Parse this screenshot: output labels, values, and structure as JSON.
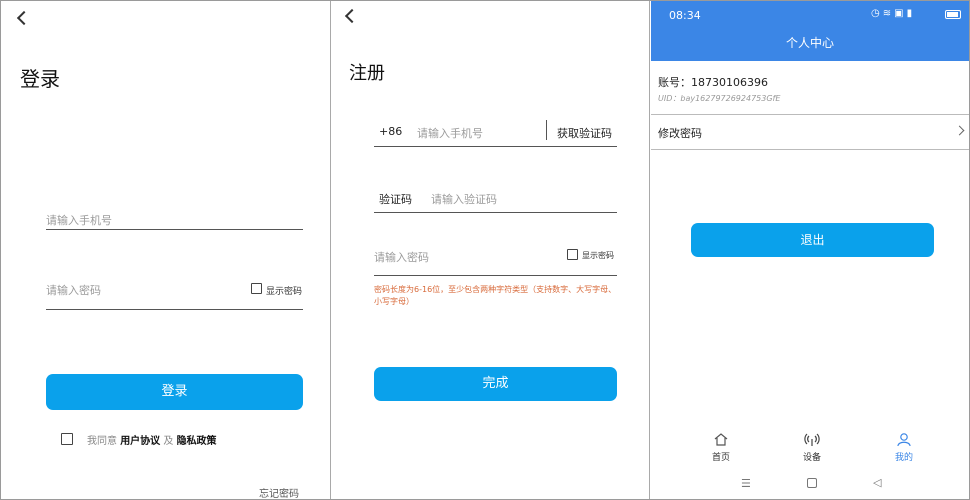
{
  "login": {
    "title": "登录",
    "phone_placeholder": "请输入手机号",
    "password_placeholder": "请输入密码",
    "show_password": "显示密码",
    "login_button": "登录",
    "agree_prefix": "我同意",
    "user_agreement": "用户协议",
    "and": "及",
    "privacy_policy": "隐私政策",
    "forgot_password": "忘记密码"
  },
  "register": {
    "title": "注册",
    "country_code": "+86",
    "phone_placeholder": "请输入手机号",
    "get_code_button": "获取验证码",
    "code_label": "验证码",
    "code_placeholder": "请输入验证码",
    "password_placeholder": "请输入密码",
    "show_password": "显示密码",
    "password_hint": "密码长度为6-16位，至少包含两种字符类型（支持数字、大写字母、小写字母）",
    "finish_button": "完成"
  },
  "profile": {
    "status_time": "08:34",
    "header_title": "个人中心",
    "account_label": "账号：18730106396",
    "uid": "UID：bay16279726924753GfE",
    "change_password": "修改密码",
    "logout_button": "退出",
    "tabs": [
      {
        "label": "首页",
        "icon": "home-icon",
        "active": false
      },
      {
        "label": "设备",
        "icon": "device-signal-icon",
        "active": false
      },
      {
        "label": "我的",
        "icon": "user-icon",
        "active": true
      }
    ],
    "active_color": "#3b86e6",
    "accent_color": "#0aa1eb"
  }
}
